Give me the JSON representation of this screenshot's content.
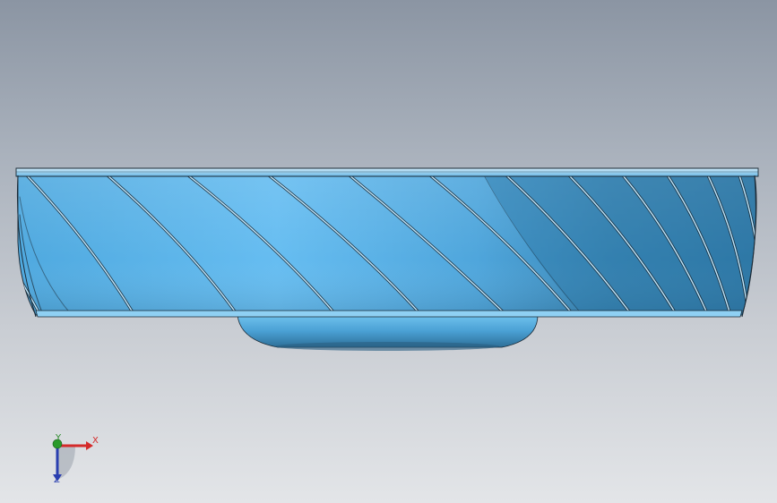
{
  "triad": {
    "x_label": "X",
    "y_label": "Y",
    "z_label": "Z"
  },
  "colors": {
    "part_light": "#6fc4f2",
    "part_mid": "#4aa8e0",
    "part_dark": "#2b6f9a",
    "edge": "#1b2a36",
    "axis_x": "#d42a2a",
    "axis_y": "#2a8a2a",
    "axis_z": "#2a3fb0"
  },
  "icons": {
    "model": "impeller-model-icon",
    "triad": "reference-triad-icon"
  }
}
